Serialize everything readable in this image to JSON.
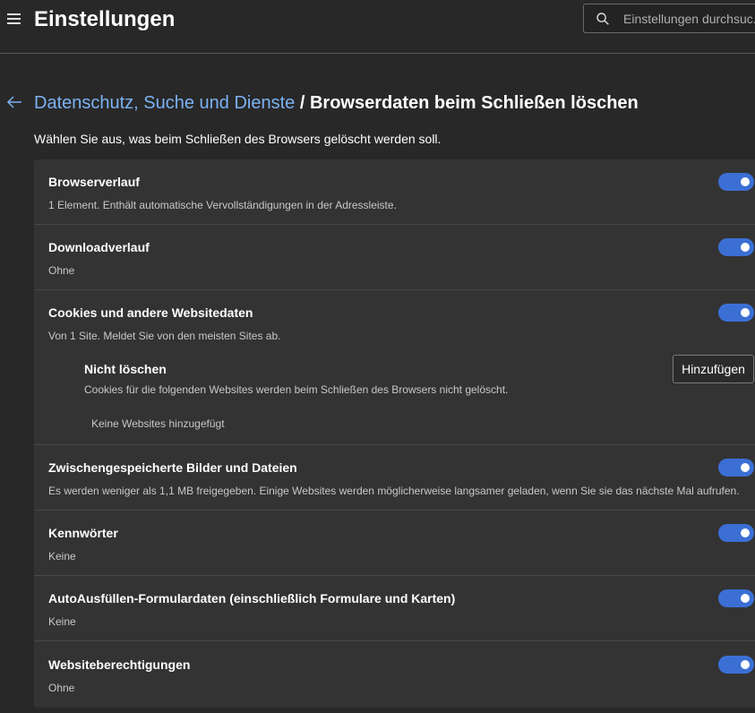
{
  "header": {
    "title": "Einstellungen",
    "search_placeholder": "Einstellungen durchsuc..."
  },
  "breadcrumb": {
    "parent": "Datenschutz, Suche und Dienste",
    "separator": "/",
    "current": "Browserdaten beim Schließen löschen"
  },
  "intro": "Wählen Sie aus, was beim Schließen des Browsers gelöscht werden soll.",
  "colors": {
    "accent": "#3b6fd4",
    "link": "#7cb2f4",
    "card": "#333333",
    "background": "#282828"
  },
  "items": [
    {
      "title": "Browserverlauf",
      "desc": "1 Element. Enthält automatische Vervollständigungen in der Adressleiste.",
      "enabled": true
    },
    {
      "title": "Downloadverlauf",
      "desc": "Ohne",
      "enabled": true
    },
    {
      "title": "Cookies und andere Websitedaten",
      "desc": "Von 1 Site. Meldet Sie von den meisten Sites ab.",
      "enabled": true
    },
    {
      "title": "Zwischengespeicherte Bilder und Dateien",
      "desc": "Es werden weniger als 1,1 MB freigegeben. Einige Websites werden möglicherweise langsamer geladen, wenn Sie sie das nächste Mal aufrufen.",
      "enabled": true
    },
    {
      "title": "Kennwörter",
      "desc": "Keine",
      "enabled": true
    },
    {
      "title": "AutoAusfüllen-Formulardaten (einschließlich Formulare und Karten)",
      "desc": "Keine",
      "enabled": true
    },
    {
      "title": "Websiteberechtigungen",
      "desc": "Ohne",
      "enabled": true
    }
  ],
  "cookies_exceptions": {
    "title": "Nicht löschen",
    "desc": "Cookies für die folgenden Websites werden beim Schließen des Browsers nicht gelöscht.",
    "add_label": "Hinzufügen",
    "empty": "Keine Websites hinzugefügt"
  }
}
